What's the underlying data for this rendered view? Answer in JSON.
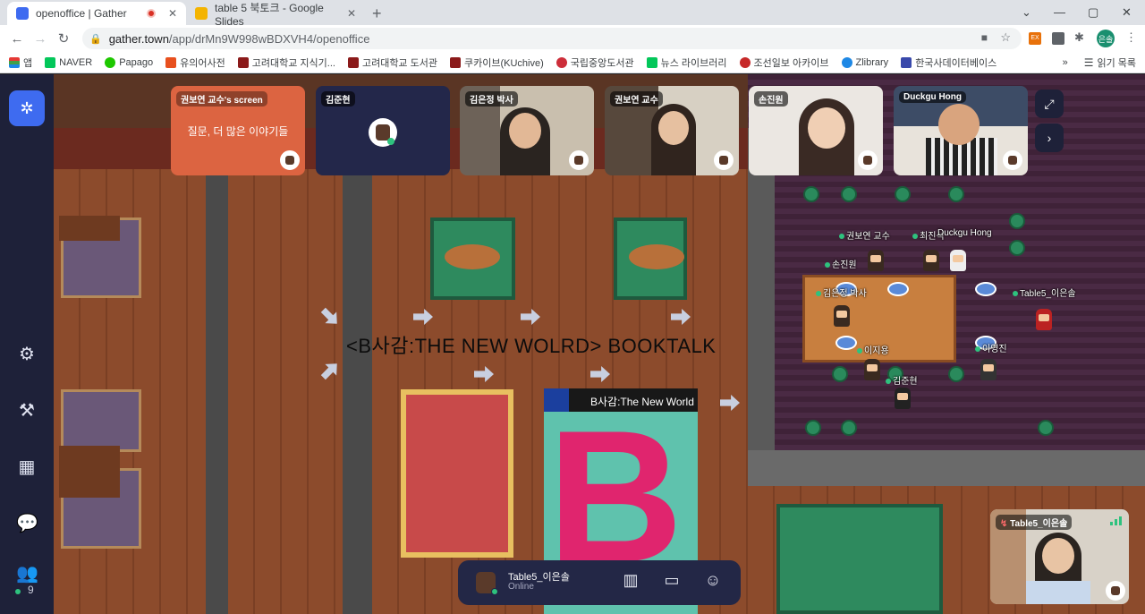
{
  "browser": {
    "tabs": [
      {
        "title": "openoffice | Gather",
        "active": true
      },
      {
        "title": "table 5 북토크 - Google Slides",
        "active": false
      }
    ],
    "url_host": "gather.town",
    "url_path": "/app/drMn9W998wBDXVH4/openoffice",
    "profile_initials": "은솔",
    "bookmarks": [
      "앱",
      "NAVER",
      "Papago",
      "유의어사전",
      "고려대학교 지식기...",
      "고려대학교 도서관",
      "쿠카이브(KUchive)",
      "국립중앙도서관",
      "뉴스 라이브러리",
      "조선일보 아카이브",
      "Zlibrary",
      "한국사데이터베이스"
    ],
    "reading_list": "읽기 목록",
    "more": "»"
  },
  "gather": {
    "online_count": "9",
    "video_tiles": [
      {
        "name": "권보연 교수's screen",
        "caption": "질문, 더 많은 이야기들"
      },
      {
        "name": "김준현"
      },
      {
        "name": "김은정 박사"
      },
      {
        "name": "권보연 교수"
      },
      {
        "name": "손진원"
      },
      {
        "name": "Duckgu Hong"
      }
    ],
    "map": {
      "banner": "<B사감:THE NEW WOLRD>  BOOKTALK",
      "poster_title": "B사감:The New World",
      "player_labels": [
        "권보연 교수",
        "최진석",
        "Duckgu Hong",
        "손진원",
        "김은정 박사",
        "Table5_이은솔",
        "이지용",
        "이영진",
        "김준현"
      ]
    },
    "self": {
      "name": "Table5_이은솔",
      "status": "Online"
    }
  },
  "colors": {
    "sidebar": "#1e2139",
    "accent": "#3e6bf0",
    "online": "#2ec27e"
  }
}
